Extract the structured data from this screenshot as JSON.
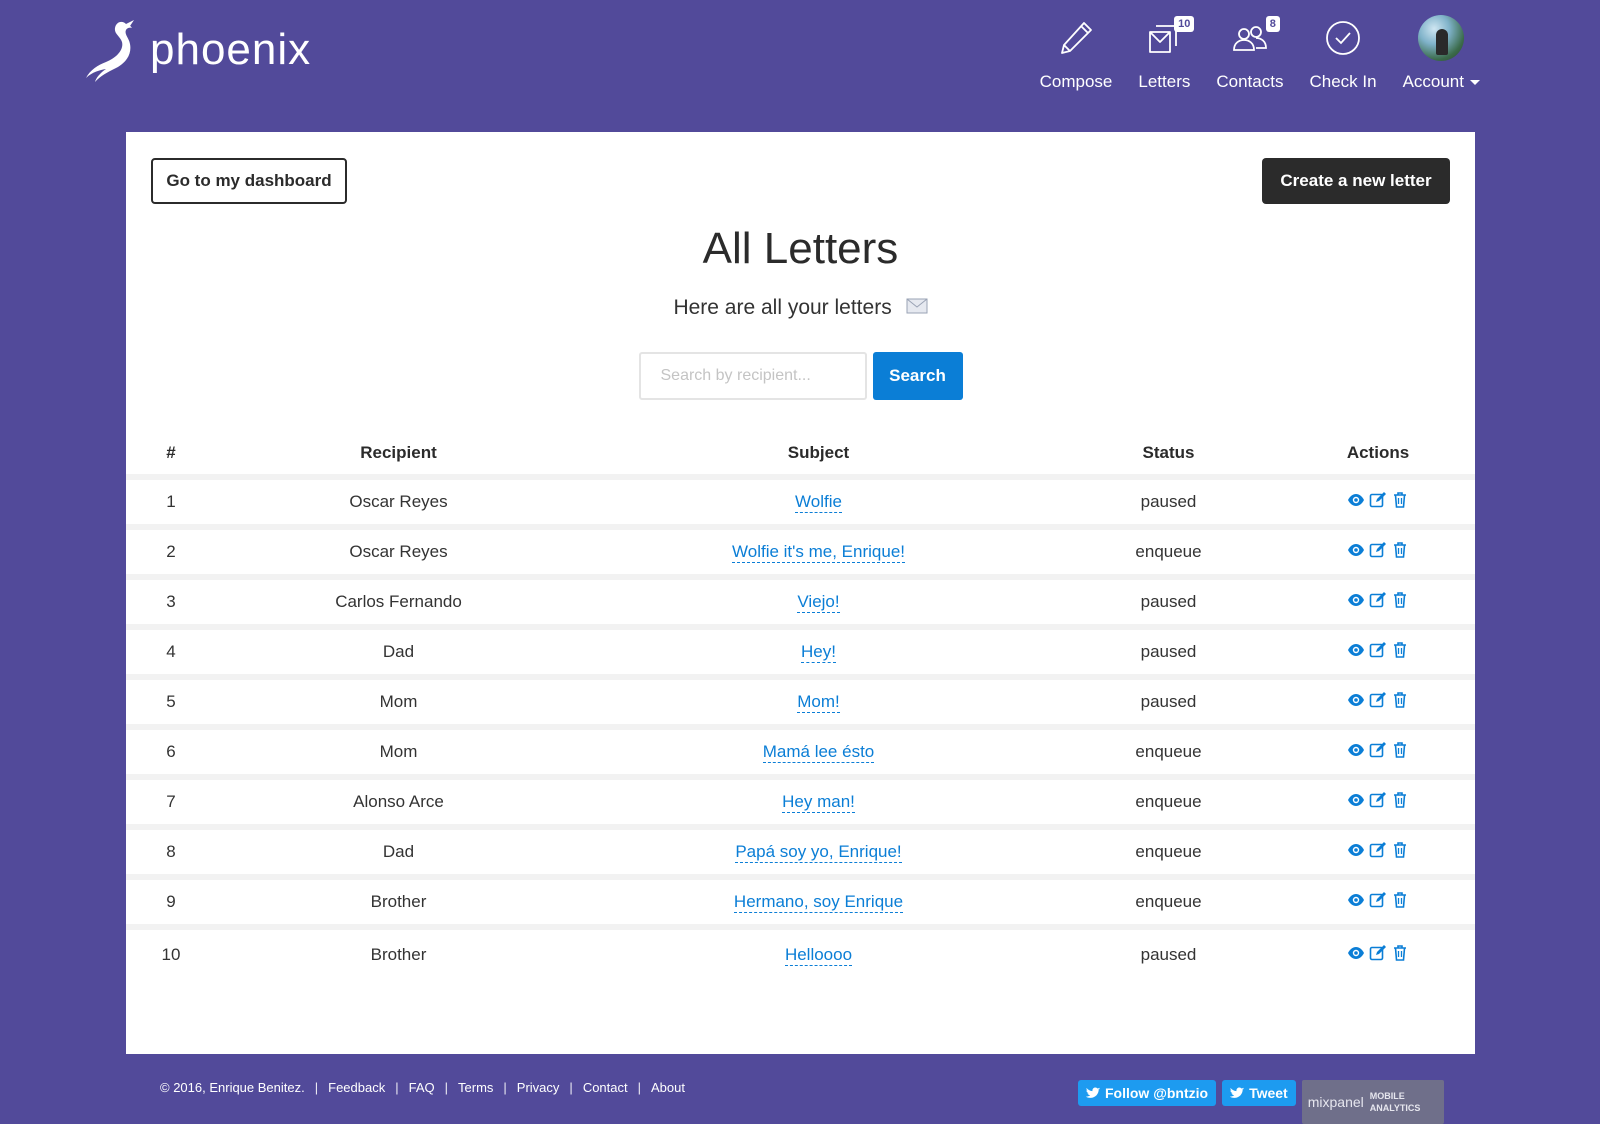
{
  "brand": {
    "name": "phoenix"
  },
  "nav": {
    "compose": "Compose",
    "letters": "Letters",
    "letters_badge": "10",
    "contacts": "Contacts",
    "contacts_badge": "8",
    "checkin": "Check In",
    "account": "Account"
  },
  "actions": {
    "dashboard": "Go to my dashboard",
    "create": "Create a new letter"
  },
  "page": {
    "title": "All Letters",
    "subtitle": "Here are all your letters"
  },
  "search": {
    "placeholder": "Search by recipient...",
    "button": "Search"
  },
  "table": {
    "headers": {
      "num": "#",
      "recipient": "Recipient",
      "subject": "Subject",
      "status": "Status",
      "actions": "Actions"
    },
    "rows": [
      {
        "num": "1",
        "recipient": "Oscar Reyes",
        "subject": "Wolfie",
        "status": "paused"
      },
      {
        "num": "2",
        "recipient": "Oscar Reyes",
        "subject": "Wolfie it's me, Enrique!",
        "status": "enqueue"
      },
      {
        "num": "3",
        "recipient": "Carlos Fernando",
        "subject": "Viejo!",
        "status": "paused"
      },
      {
        "num": "4",
        "recipient": "Dad",
        "subject": "Hey!",
        "status": "paused"
      },
      {
        "num": "5",
        "recipient": "Mom",
        "subject": "Mom!",
        "status": "paused"
      },
      {
        "num": "6",
        "recipient": "Mom",
        "subject": "Mamá lee ésto",
        "status": "enqueue"
      },
      {
        "num": "7",
        "recipient": "Alonso Arce",
        "subject": "Hey man!",
        "status": "enqueue"
      },
      {
        "num": "8",
        "recipient": "Dad",
        "subject": "Papá soy yo, Enrique!",
        "status": "enqueue"
      },
      {
        "num": "9",
        "recipient": "Brother",
        "subject": "Hermano, soy Enrique",
        "status": "enqueue"
      },
      {
        "num": "10",
        "recipient": "Brother",
        "subject": "Helloooo",
        "status": "paused"
      }
    ]
  },
  "footer": {
    "copyright": "© 2016, Enrique Benitez.",
    "links": [
      "Feedback",
      "FAQ",
      "Terms",
      "Privacy",
      "Contact",
      "About"
    ],
    "follow": "Follow @bntzio",
    "tweet": "Tweet",
    "mixpanel_name": "mixpanel",
    "mixpanel_line1": "MOBILE",
    "mixpanel_line2": "ANALYTICS"
  },
  "colors": {
    "background": "#524a9a",
    "link": "#0b7ed6",
    "dark_button": "#2b2b2b",
    "twitter": "#1d9bf0"
  },
  "icons": {
    "row_actions": [
      "eye-icon",
      "edit-icon",
      "trash-icon"
    ],
    "nav": [
      "pencil-icon",
      "envelopes-icon",
      "contacts-icon",
      "check-circle-icon",
      "avatar"
    ]
  }
}
